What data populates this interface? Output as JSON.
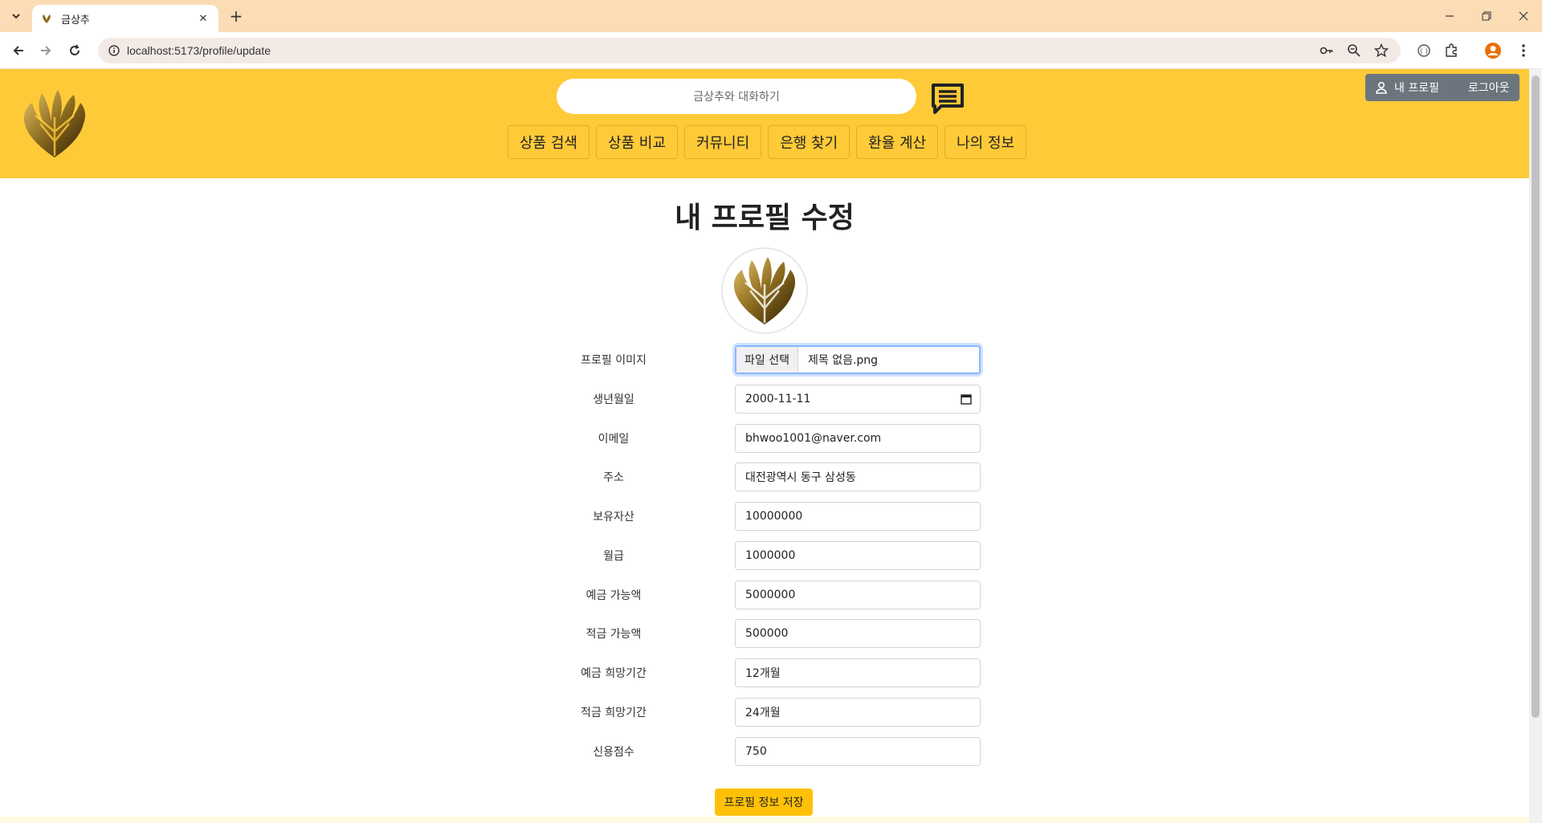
{
  "browser": {
    "tab_title": "금상추",
    "url": "localhost:5173/profile/update"
  },
  "header": {
    "chat_placeholder": "금상추와 대화하기",
    "profile_button": "내 프로필",
    "logout_button": "로그아웃",
    "nav": [
      "상품 검색",
      "상품 비교",
      "커뮤니티",
      "은행 찾기",
      "환율 계산",
      "나의 정보"
    ]
  },
  "page": {
    "title": "내 프로필 수정"
  },
  "form": {
    "profile_image": {
      "label": "프로필 이미지",
      "button": "파일 선택",
      "file_name": "제목 없음.png"
    },
    "birthdate": {
      "label": "생년월일",
      "value": "2000-11-11"
    },
    "email": {
      "label": "이메일",
      "value": "bhwoo1001@naver.com"
    },
    "address": {
      "label": "주소",
      "value": "대전광역시 동구 삼성동"
    },
    "assets": {
      "label": "보유자산",
      "value": "10000000"
    },
    "salary": {
      "label": "월급",
      "value": "1000000"
    },
    "deposit_amount": {
      "label": "예금 가능액",
      "value": "5000000"
    },
    "saving_amount": {
      "label": "적금 가능액",
      "value": "500000"
    },
    "deposit_period": {
      "label": "예금 희망기간",
      "value": "12개월"
    },
    "saving_period": {
      "label": "적금 희망기간",
      "value": "24개월"
    },
    "credit_score": {
      "label": "신용점수",
      "value": "750"
    },
    "save_button": "프로필 정보 저장"
  },
  "colors": {
    "header_bg": "#ffca38",
    "tabbar_bg": "#fcdcb5",
    "save_button": "#ffc107",
    "header_button": "#6c757d"
  }
}
